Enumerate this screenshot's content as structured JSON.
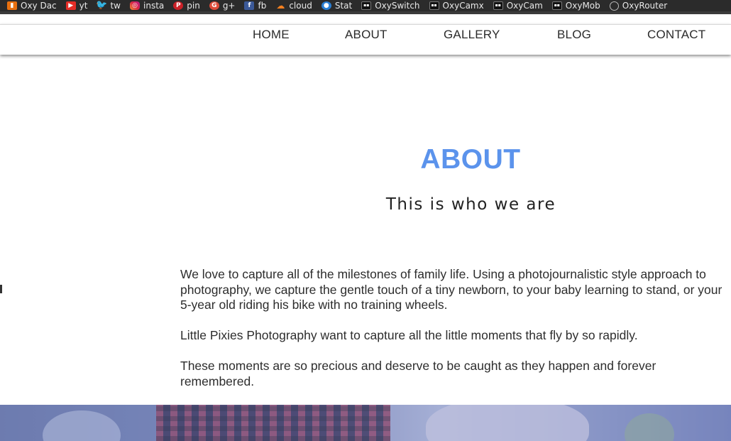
{
  "bookmarks": [
    {
      "label": "Oxy Dac",
      "icon": "oxy-dac-icon"
    },
    {
      "label": "yt",
      "icon": "youtube-icon"
    },
    {
      "label": "tw",
      "icon": "twitter-icon"
    },
    {
      "label": "insta",
      "icon": "instagram-icon"
    },
    {
      "label": "pin",
      "icon": "pinterest-icon"
    },
    {
      "label": "g+",
      "icon": "google-plus-icon"
    },
    {
      "label": "fb",
      "icon": "facebook-icon"
    },
    {
      "label": "cloud",
      "icon": "cloud-icon"
    },
    {
      "label": "Stat",
      "icon": "stat-icon"
    },
    {
      "label": "OxySwitch",
      "icon": "oxyswitch-icon"
    },
    {
      "label": "OxyCamx",
      "icon": "oxycamx-icon"
    },
    {
      "label": "OxyCam",
      "icon": "oxycam-icon"
    },
    {
      "label": "OxyMob",
      "icon": "oxymob-icon"
    },
    {
      "label": "OxyRouter",
      "icon": "globe-icon"
    }
  ],
  "nav": {
    "home": "HOME",
    "about": "ABOUT",
    "gallery": "GALLERY",
    "blog": "BLOG",
    "contact": "CONTACT"
  },
  "about": {
    "title": "ABOUT",
    "subtitle": "This is who we are",
    "paragraphs": [
      "We love to capture all of the milestones of family life. Using a photojournalistic style approach to photography, we capture the gentle touch of a tiny newborn, to your baby learning to stand, or your 5-year old riding his bike with no training wheels.",
      "Little Pixies Photography want to capture all the little moments that fly by so rapidly.",
      "These moments are so precious and deserve to be caught as they happen and forever remembered."
    ]
  },
  "colors": {
    "accent": "#5b93ec",
    "bookmark_bar": "#2b2b2b",
    "text": "#2d2d2d"
  }
}
